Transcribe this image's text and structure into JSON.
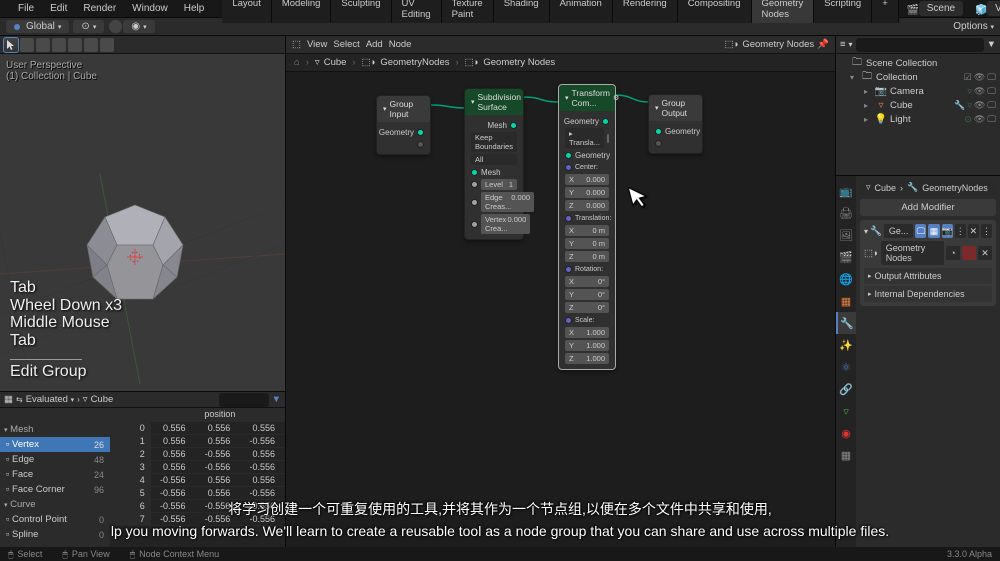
{
  "menu": {
    "file": "File",
    "edit": "Edit",
    "render": "Render",
    "window": "Window",
    "help": "Help"
  },
  "tabs": {
    "layout": "Layout",
    "modeling": "Modeling",
    "sculpting": "Sculpting",
    "uv": "UV Editing",
    "texture": "Texture Paint",
    "shading": "Shading",
    "animation": "Animation",
    "rendering": "Rendering",
    "compositing": "Compositing",
    "geometry": "Geometry Nodes",
    "scripting": "Scripting"
  },
  "scene": {
    "label": "Scene",
    "viewlayer": "ViewLayer"
  },
  "secondary": {
    "global": "Global",
    "options": "Options"
  },
  "viewport": {
    "perspective": "User Perspective",
    "collection": "(1) Collection | Cube",
    "hints": [
      "Tab",
      "Wheel Down x3",
      "Middle Mouse",
      "Tab"
    ],
    "hint_bottom": "Edit Group"
  },
  "spreadsheet": {
    "evaluated": "Evaluated",
    "cube": "Cube",
    "groups": {
      "mesh": "Mesh",
      "curve": "Curve"
    },
    "cats": [
      {
        "name": "Vertex",
        "count": "26",
        "sel": true
      },
      {
        "name": "Edge",
        "count": "48"
      },
      {
        "name": "Face",
        "count": "24"
      },
      {
        "name": "Face Corner",
        "count": "96"
      },
      {
        "name": "Control Point",
        "count": "0"
      },
      {
        "name": "Spline",
        "count": "0"
      }
    ],
    "col_header": "position",
    "rows": [
      {
        "i": "0",
        "a": "0.556",
        "b": "0.556",
        "c": "0.556"
      },
      {
        "i": "1",
        "a": "0.556",
        "b": "0.556",
        "c": "-0.556"
      },
      {
        "i": "2",
        "a": "0.556",
        "b": "-0.556",
        "c": "0.556"
      },
      {
        "i": "3",
        "a": "0.556",
        "b": "-0.556",
        "c": "-0.556"
      },
      {
        "i": "4",
        "a": "-0.556",
        "b": "0.556",
        "c": "0.556"
      },
      {
        "i": "5",
        "a": "-0.556",
        "b": "0.556",
        "c": "-0.556"
      },
      {
        "i": "6",
        "a": "-0.556",
        "b": "-0.556",
        "c": "0.556"
      },
      {
        "i": "7",
        "a": "-0.556",
        "b": "-0.556",
        "c": "-0.556"
      }
    ]
  },
  "node_editor": {
    "header": {
      "view": "View",
      "select": "Select",
      "add": "Add",
      "node": "Node",
      "name": "Geometry Nodes"
    },
    "crumbs": [
      "Cube",
      "GeometryNodes",
      "Geometry Nodes"
    ],
    "nodes": {
      "group_input": {
        "title": "Group Input",
        "out": "Geometry"
      },
      "subdiv": {
        "title": "Subdivision Surface",
        "mesh": "Mesh",
        "all": "All",
        "keep": "Keep Boundaries",
        "level": "Level",
        "level_v": "1",
        "crease": "Edge Creas...",
        "crease_v": "0.000",
        "vcrease": "Vertex Crea...",
        "vcrease_v": "0.000"
      },
      "transform": {
        "title": "Transform Com...",
        "out": "Geometry",
        "transl": "Transla...",
        "geom": "Geometry",
        "center": "Center:",
        "x": "X",
        "y": "Y",
        "z": "Z",
        "c0": "0.000",
        "c1": "0.000",
        "c2": "0.000",
        "translation": "Translation:",
        "t0": "0 m",
        "t1": "0 m",
        "t2": "0 m",
        "rotation": "Rotation:",
        "r0": "0°",
        "r1": "0°",
        "r2": "0°",
        "scale": "Scale:",
        "s0": "1.000",
        "s1": "1.000",
        "s2": "1.000"
      },
      "group_output": {
        "title": "Group Output",
        "in": "Geometry"
      }
    }
  },
  "outliner": {
    "scene_collection": "Scene Collection",
    "collection": "Collection",
    "camera": "Camera",
    "cube": "Cube",
    "light": "Light"
  },
  "properties": {
    "breadcrumb_cube": "Cube",
    "breadcrumb_gn": "GeometryNodes",
    "add_modifier": "Add Modifier",
    "mod_label": "Ge...",
    "node_group": "Geometry Nodes",
    "output_attr": "Output Attributes",
    "internal_dep": "Internal Dependencies"
  },
  "status": {
    "select": "Select",
    "pan": "Pan View",
    "context": "Node Context Menu",
    "version": "3.3.0 Alpha"
  },
  "subtitles": {
    "cn": "将学习创建一个可重复使用的工具,并将其作为一个节点组,以便在多个文件中共享和使用,",
    "en": "lp you moving forwards. We'll learn to create a reusable tool as a node group that you can share and use across multiple files."
  }
}
